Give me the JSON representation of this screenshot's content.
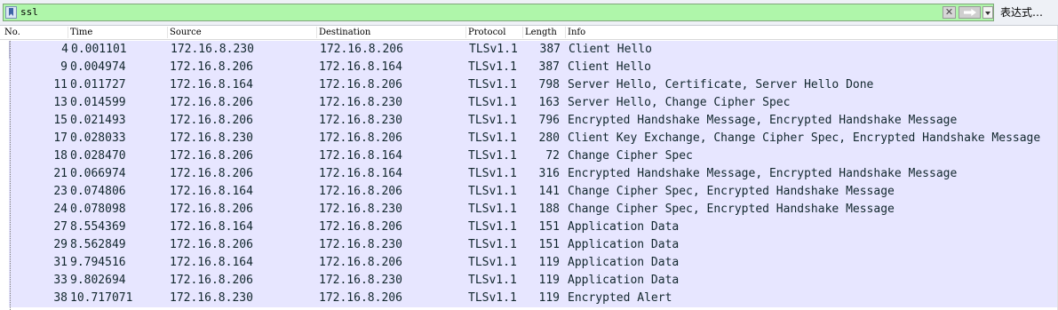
{
  "filter": {
    "value": "ssl",
    "expression_label": "表达式…"
  },
  "columns": {
    "no": "No.",
    "time": "Time",
    "source": "Source",
    "destination": "Destination",
    "protocol": "Protocol",
    "length": "Length",
    "info": "Info"
  },
  "colors": {
    "filter_valid_bg": "#aff6aa",
    "row_bg": "#e7e6ff",
    "row_text": "#12272e"
  },
  "packets": [
    {
      "no": "4",
      "time": "0.001101",
      "source": "172.16.8.230",
      "destination": "172.16.8.206",
      "protocol": "TLSv1.1",
      "length": "387",
      "info": "Client Hello"
    },
    {
      "no": "9",
      "time": "0.004974",
      "source": "172.16.8.206",
      "destination": "172.16.8.164",
      "protocol": "TLSv1.1",
      "length": "387",
      "info": "Client Hello"
    },
    {
      "no": "11",
      "time": "0.011727",
      "source": "172.16.8.164",
      "destination": "172.16.8.206",
      "protocol": "TLSv1.1",
      "length": "798",
      "info": "Server Hello, Certificate, Server Hello Done"
    },
    {
      "no": "13",
      "time": "0.014599",
      "source": "172.16.8.206",
      "destination": "172.16.8.230",
      "protocol": "TLSv1.1",
      "length": "163",
      "info": "Server Hello, Change Cipher Spec"
    },
    {
      "no": "15",
      "time": "0.021493",
      "source": "172.16.8.206",
      "destination": "172.16.8.230",
      "protocol": "TLSv1.1",
      "length": "796",
      "info": "Encrypted Handshake Message, Encrypted Handshake Message"
    },
    {
      "no": "17",
      "time": "0.028033",
      "source": "172.16.8.230",
      "destination": "172.16.8.206",
      "protocol": "TLSv1.1",
      "length": "280",
      "info": "Client Key Exchange, Change Cipher Spec, Encrypted Handshake Message"
    },
    {
      "no": "18",
      "time": "0.028470",
      "source": "172.16.8.206",
      "destination": "172.16.8.164",
      "protocol": "TLSv1.1",
      "length": "72",
      "info": "Change Cipher Spec"
    },
    {
      "no": "21",
      "time": "0.066974",
      "source": "172.16.8.206",
      "destination": "172.16.8.164",
      "protocol": "TLSv1.1",
      "length": "316",
      "info": "Encrypted Handshake Message, Encrypted Handshake Message"
    },
    {
      "no": "23",
      "time": "0.074806",
      "source": "172.16.8.164",
      "destination": "172.16.8.206",
      "protocol": "TLSv1.1",
      "length": "141",
      "info": "Change Cipher Spec, Encrypted Handshake Message"
    },
    {
      "no": "24",
      "time": "0.078098",
      "source": "172.16.8.206",
      "destination": "172.16.8.230",
      "protocol": "TLSv1.1",
      "length": "188",
      "info": "Change Cipher Spec, Encrypted Handshake Message"
    },
    {
      "no": "27",
      "time": "8.554369",
      "source": "172.16.8.164",
      "destination": "172.16.8.206",
      "protocol": "TLSv1.1",
      "length": "151",
      "info": "Application Data"
    },
    {
      "no": "29",
      "time": "8.562849",
      "source": "172.16.8.206",
      "destination": "172.16.8.230",
      "protocol": "TLSv1.1",
      "length": "151",
      "info": "Application Data"
    },
    {
      "no": "31",
      "time": "9.794516",
      "source": "172.16.8.164",
      "destination": "172.16.8.206",
      "protocol": "TLSv1.1",
      "length": "119",
      "info": "Application Data"
    },
    {
      "no": "33",
      "time": "9.802694",
      "source": "172.16.8.206",
      "destination": "172.16.8.230",
      "protocol": "TLSv1.1",
      "length": "119",
      "info": "Application Data"
    },
    {
      "no": "38",
      "time": "10.717071",
      "source": "172.16.8.230",
      "destination": "172.16.8.206",
      "protocol": "TLSv1.1",
      "length": "119",
      "info": "Encrypted Alert"
    }
  ]
}
